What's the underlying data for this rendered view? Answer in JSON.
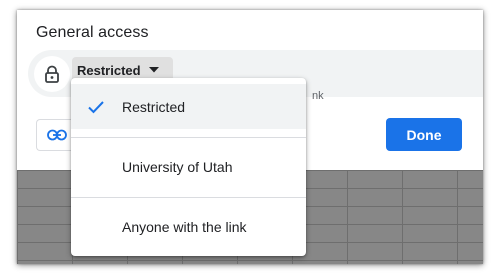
{
  "dialog": {
    "title": "General access",
    "access_select_label": "Restricted",
    "access_description_fragment": "nk",
    "done_label": "Done"
  },
  "menu": {
    "items": [
      {
        "label": "Restricted",
        "selected": true
      },
      {
        "label": "University of Utah",
        "selected": false
      },
      {
        "label": "Anyone with the link",
        "selected": false
      }
    ]
  },
  "colors": {
    "accent": "#1a73e8",
    "check": "#1a73e8",
    "row_background": "#f1f3f4",
    "sheet_background": "#878787"
  },
  "icons": [
    "lock-icon",
    "dropdown-arrow-icon",
    "link-icon",
    "check-icon"
  ]
}
